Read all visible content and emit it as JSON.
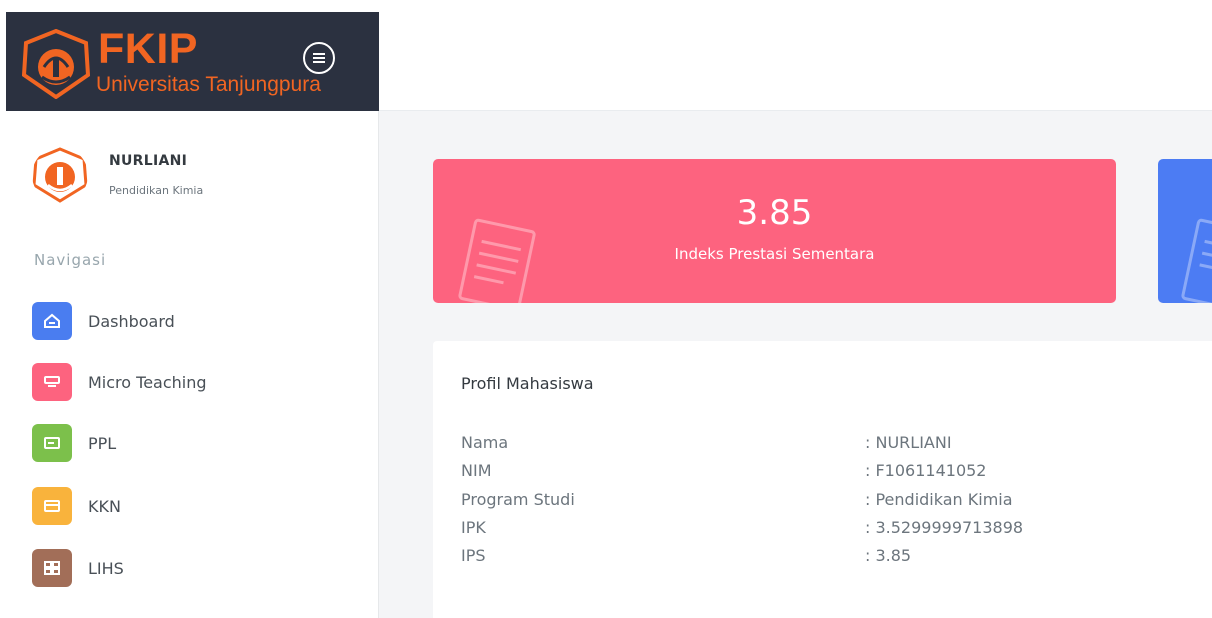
{
  "brand": {
    "title": "FKIP",
    "subtitle": "Universitas Tanjungpura",
    "accent": "#f16522",
    "background": "#2b3140",
    "logo_icon": "university-seal-icon",
    "menu_icon": "menu-icon"
  },
  "user": {
    "name": "NURLIANI",
    "program": "Pendidikan Kimia",
    "avatar_icon": "university-seal-icon"
  },
  "sidebar": {
    "nav_title": "Navigasi",
    "items": [
      {
        "label": "Dashboard",
        "icon": "home-icon",
        "color": "#4a7df0"
      },
      {
        "label": "Micro Teaching",
        "icon": "teaching-icon",
        "color": "#fd637f"
      },
      {
        "label": "PPL",
        "icon": "card-icon",
        "color": "#7cc04b"
      },
      {
        "label": "KKN",
        "icon": "wallet-icon",
        "color": "#f9b33c"
      },
      {
        "label": "LIHS",
        "icon": "grid-icon",
        "color": "#a26e58"
      }
    ]
  },
  "stats": {
    "ip_value": "3.85",
    "ip_label": "Indeks Prestasi Sementara",
    "ip_color": "#fd637f",
    "blue_color": "#4c7cf3"
  },
  "profile": {
    "title": "Profil Mahasiswa",
    "rows": [
      {
        "key": "Nama",
        "value": ": NURLIANI"
      },
      {
        "key": "NIM",
        "value": ": F1061141052"
      },
      {
        "key": "Program Studi",
        "value": ": Pendidikan Kimia"
      },
      {
        "key": "IPK",
        "value": ": 3.5299999713898"
      },
      {
        "key": "IPS",
        "value": ": 3.85"
      }
    ]
  }
}
